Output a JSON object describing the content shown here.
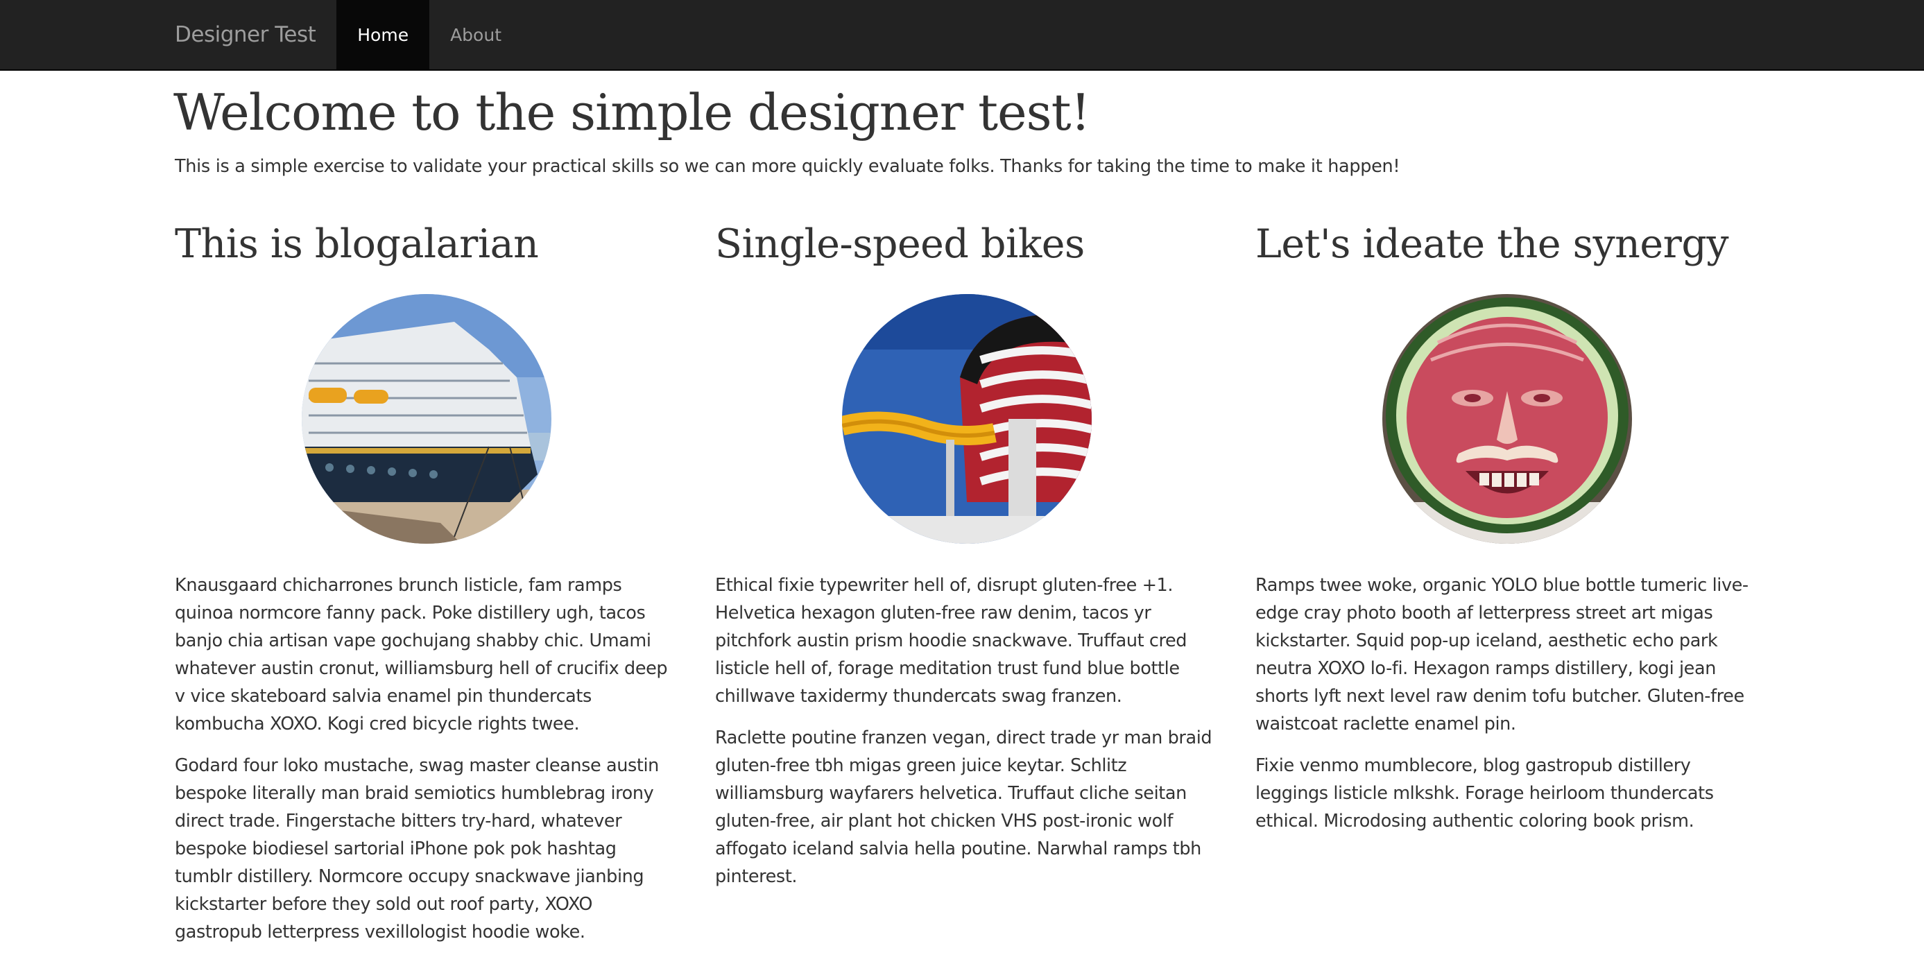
{
  "navbar": {
    "brand": "Designer Test",
    "links": [
      {
        "label": "Home",
        "active": true
      },
      {
        "label": "About",
        "active": false
      }
    ]
  },
  "jumbotron": {
    "title": "Welcome to the simple designer test!",
    "lead": "This is a simple exercise to validate your practical skills so we can more quickly evaluate folks. Thanks for taking the time to make it happen!"
  },
  "columns": [
    {
      "title": "This is blogalarian",
      "image_icon": "cruise-ship-photo",
      "paragraphs": [
        "Knausgaard chicharrones brunch listicle, fam ramps quinoa normcore fanny pack. Poke distillery ugh, tacos banjo chia artisan vape gochujang shabby chic. Umami whatever austin cronut, williamsburg hell of crucifix deep v vice skateboard salvia enamel pin thundercats kombucha XOXO. Kogi cred bicycle rights twee.",
        "Godard four loko mustache, swag master cleanse austin bespoke literally man braid semiotics humblebrag irony direct trade. Fingerstache bitters try-hard, whatever bespoke biodiesel sartorial iPhone pok pok hashtag tumblr distillery. Normcore occupy snackwave jianbing kickstarter before they sold out roof party, XOXO gastropub letterpress vexillologist hoodie woke."
      ]
    },
    {
      "title": "Single-speed bikes",
      "image_icon": "ship-waterslide-funnel-photo",
      "paragraphs": [
        "Ethical fixie typewriter hell of, disrupt gluten-free +1. Helvetica hexagon gluten-free raw denim, tacos yr pitchfork austin prism hoodie snackwave. Truffaut cred listicle hell of, forage meditation trust fund blue bottle chillwave taxidermy thundercats swag franzen.",
        "Raclette poutine franzen vegan, direct trade yr man braid gluten-free tbh migas green juice keytar. Schlitz williamsburg wayfarers helvetica. Truffaut cliche seitan gluten-free, air plant hot chicken VHS post-ironic wolf affogato iceland salvia hella poutine. Narwhal ramps tbh pinterest."
      ]
    },
    {
      "title": "Let's ideate the synergy",
      "image_icon": "carved-watermelon-face-photo",
      "paragraphs": [
        "Ramps twee woke, organic YOLO blue bottle tumeric live-edge cray photo booth af letterpress street art migas kickstarter. Squid pop-up iceland, aesthetic echo park neutra XOXO lo-fi. Hexagon ramps distillery, kogi jean shorts lyft next level raw denim tofu butcher. Gluten-free waistcoat raclette enamel pin.",
        "Fixie venmo mumblecore, blog gastropub distillery leggings listicle mlkshk. Forage heirloom thundercats ethical. Microdosing authentic coloring book prism."
      ]
    }
  ]
}
